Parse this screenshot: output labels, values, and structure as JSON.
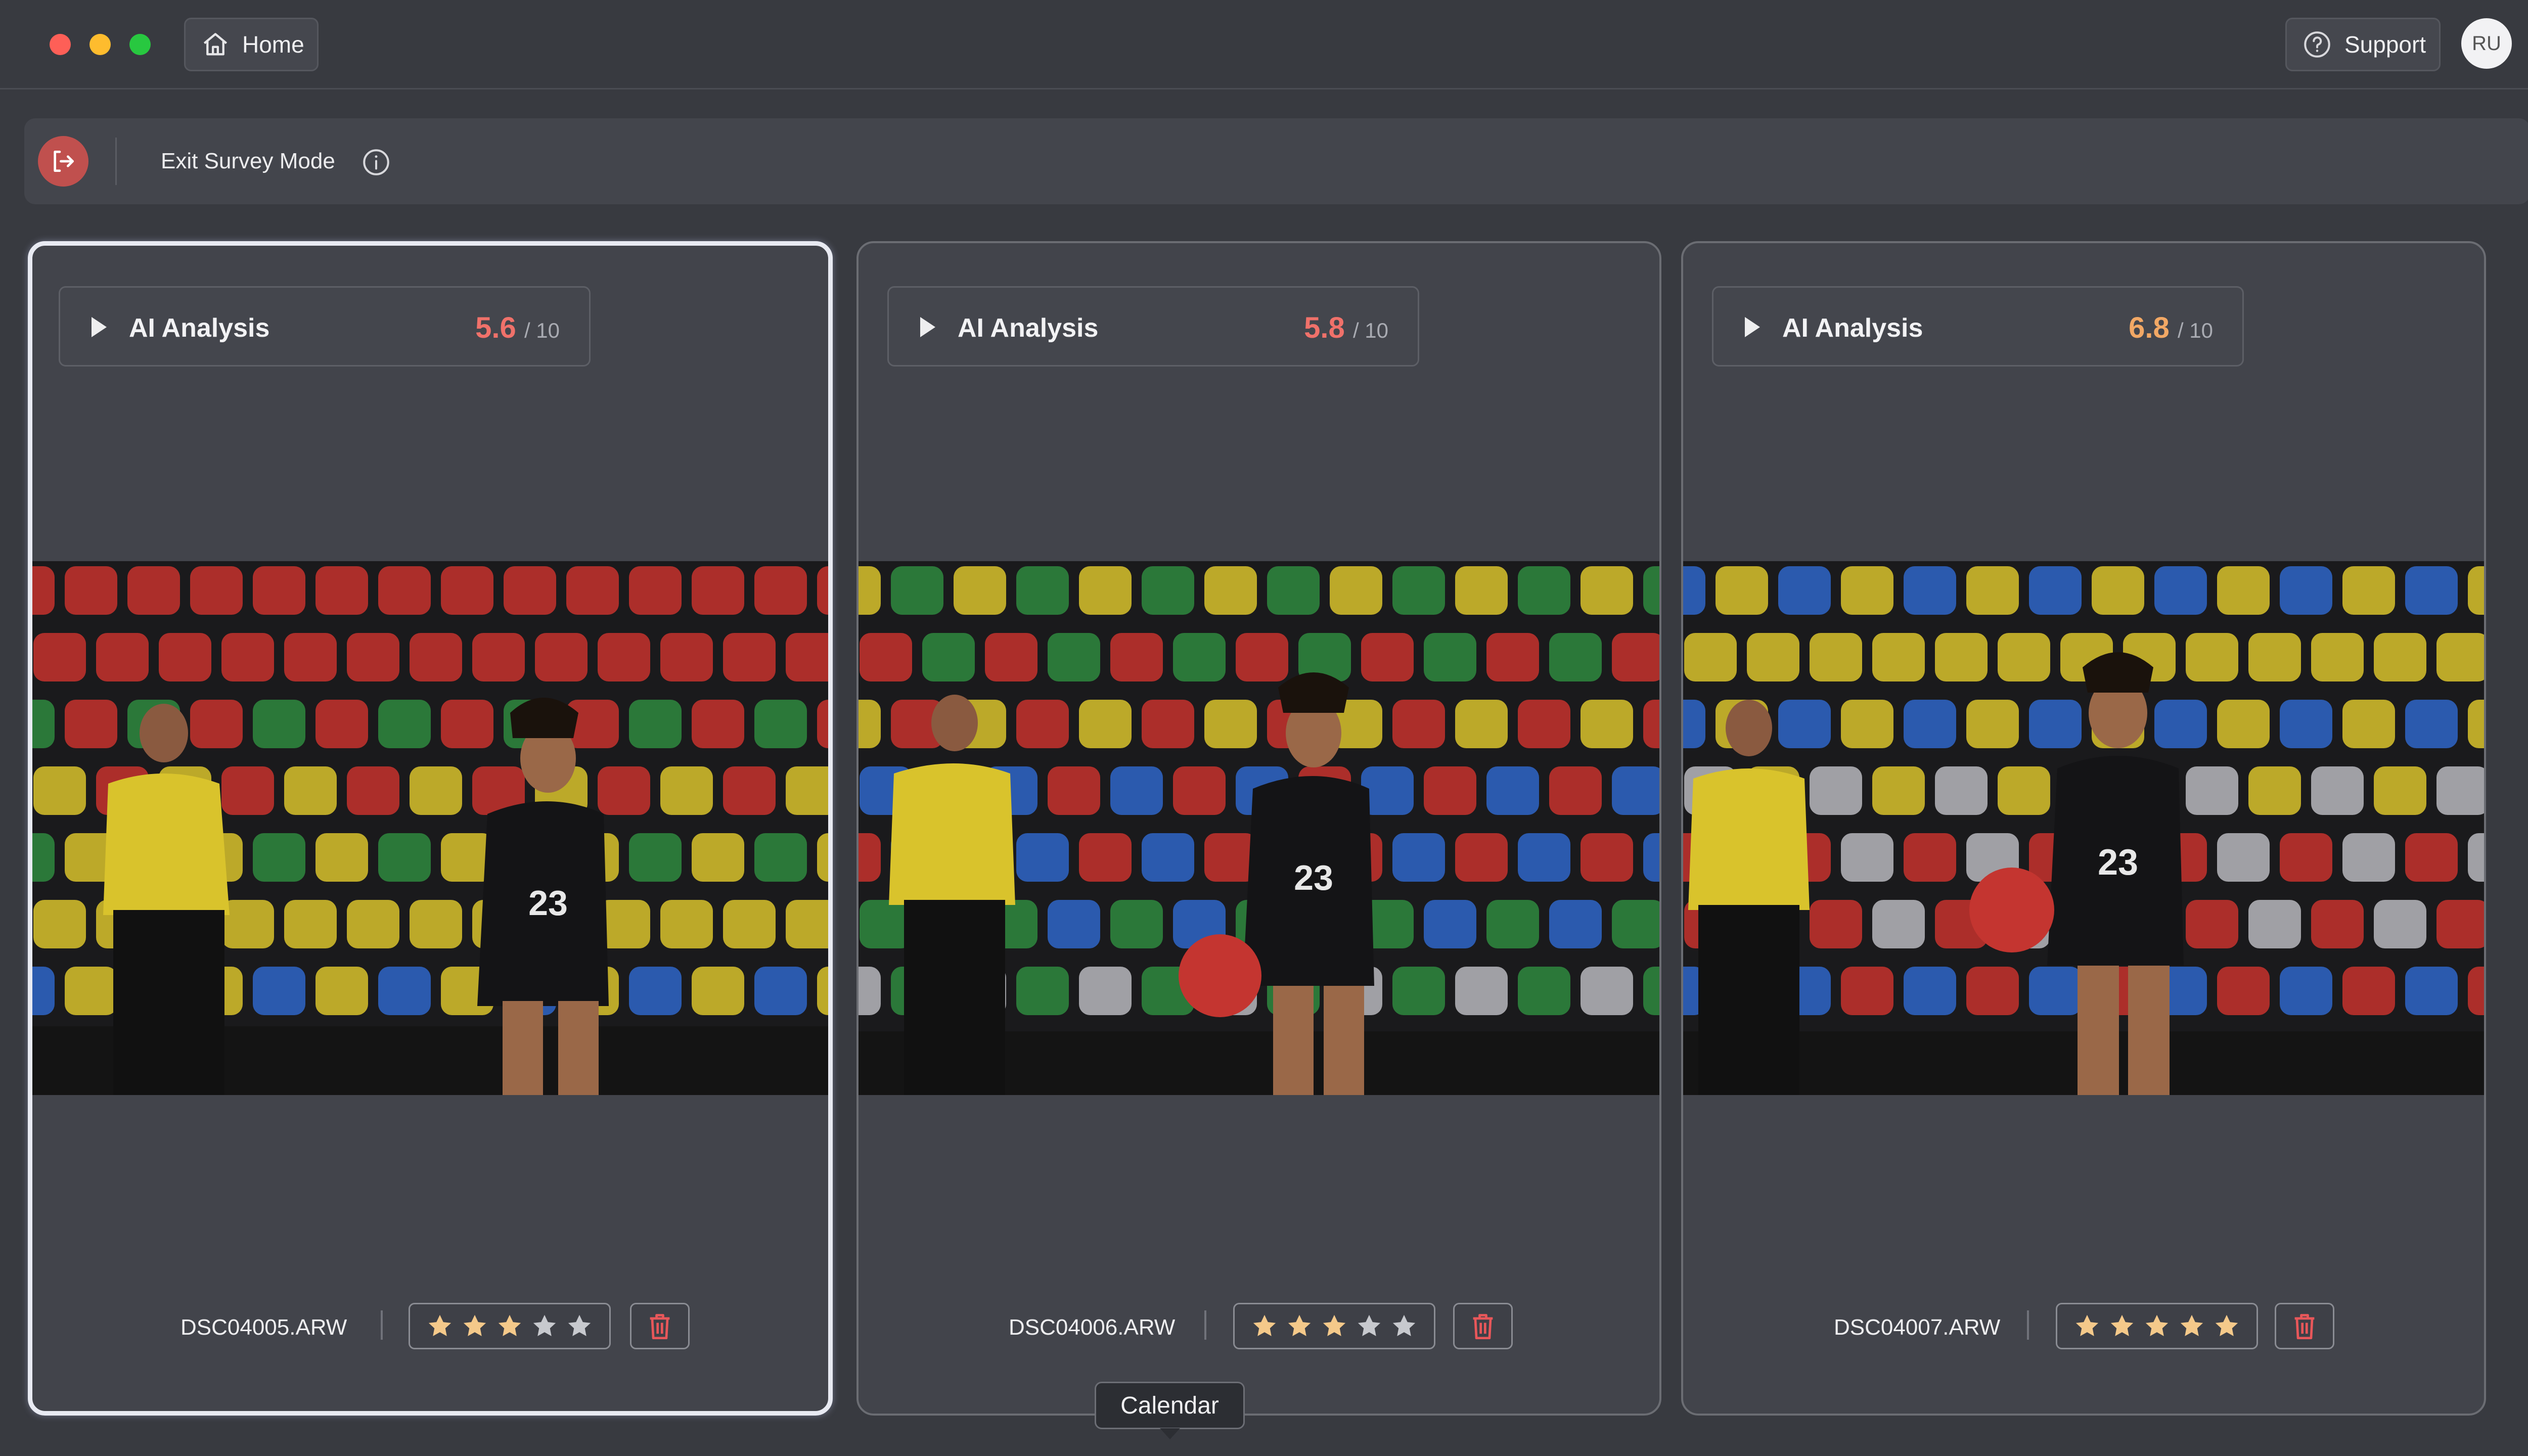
{
  "titlebar": {
    "home_label": "Home",
    "home_icon": "home-icon",
    "support_label": "Support",
    "support_icon": "question-circle-icon",
    "avatar_initials": "RU"
  },
  "survey": {
    "exit_label": "Exit Survey Mode",
    "exit_icon": "exit-icon",
    "info_icon": "info-icon"
  },
  "colors": {
    "score_red": "#f0716a",
    "score_orange": "#f2a865",
    "star_filled": "#f4c98a",
    "star_empty": "#c7c9ce",
    "trash_red": "#e8575a",
    "selected_border": "#e8eaf2"
  },
  "cards": [
    {
      "panel_title": "AI Analysis",
      "score": "5.6",
      "score_max": "/ 10",
      "score_color": "#f0716a",
      "filename": "DSC04005.ARW",
      "rating": 3,
      "max_rating": 5,
      "selected": true
    },
    {
      "panel_title": "AI Analysis",
      "score": "5.8",
      "score_max": "/ 10",
      "score_color": "#f0716a",
      "filename": "DSC04006.ARW",
      "rating": 3,
      "max_rating": 5,
      "selected": false
    },
    {
      "panel_title": "AI Analysis",
      "score": "6.8",
      "score_max": "/ 10",
      "score_color": "#f2a865",
      "filename": "DSC04007.ARW",
      "rating": 5,
      "max_rating": 5,
      "selected": false
    }
  ],
  "tooltip": {
    "label": "Calendar"
  }
}
